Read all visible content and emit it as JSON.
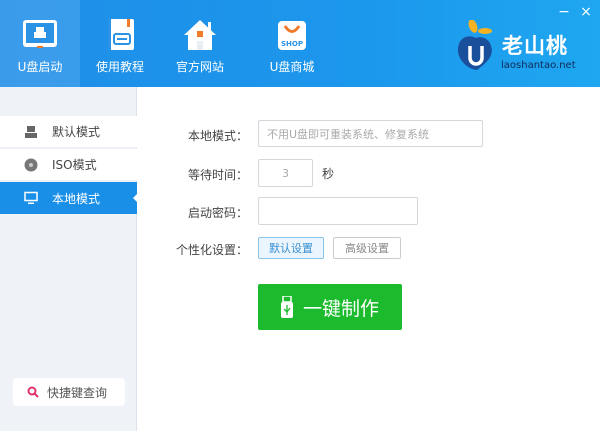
{
  "header": {
    "nav": [
      {
        "label": "U盘启动",
        "icon": "monitor-icon"
      },
      {
        "label": "使用教程",
        "icon": "book-icon"
      },
      {
        "label": "官方网站",
        "icon": "house-icon"
      },
      {
        "label": "U盘商城",
        "icon": "shop-bag-icon"
      }
    ],
    "shop_badge": "SHOP",
    "logo": {
      "name": "老山桃",
      "url_text": "laoshantao.net"
    },
    "minimize": "−",
    "close": "×"
  },
  "sidebar": {
    "items": [
      {
        "label": "默认模式",
        "icon": "usb-drive-icon"
      },
      {
        "label": "ISO模式",
        "icon": "disc-icon"
      },
      {
        "label": "本地模式",
        "icon": "monitor-icon"
      }
    ],
    "active": 2,
    "hotkey_label": "快捷键查询"
  },
  "form": {
    "mode_label": "本地模式：",
    "mode_placeholder": "不用U盘即可重装系统、修复系统",
    "wait_label": "等待时间：",
    "wait_value": "3",
    "wait_unit": "秒",
    "password_label": "启动密码：",
    "password_value": "",
    "personal_label": "个性化设置：",
    "default_btn": "默认设置",
    "advanced_btn": "高级设置",
    "make_btn": "一键制作"
  },
  "colors": {
    "accent": "#1a8fe8",
    "make": "#1bbb2d"
  }
}
